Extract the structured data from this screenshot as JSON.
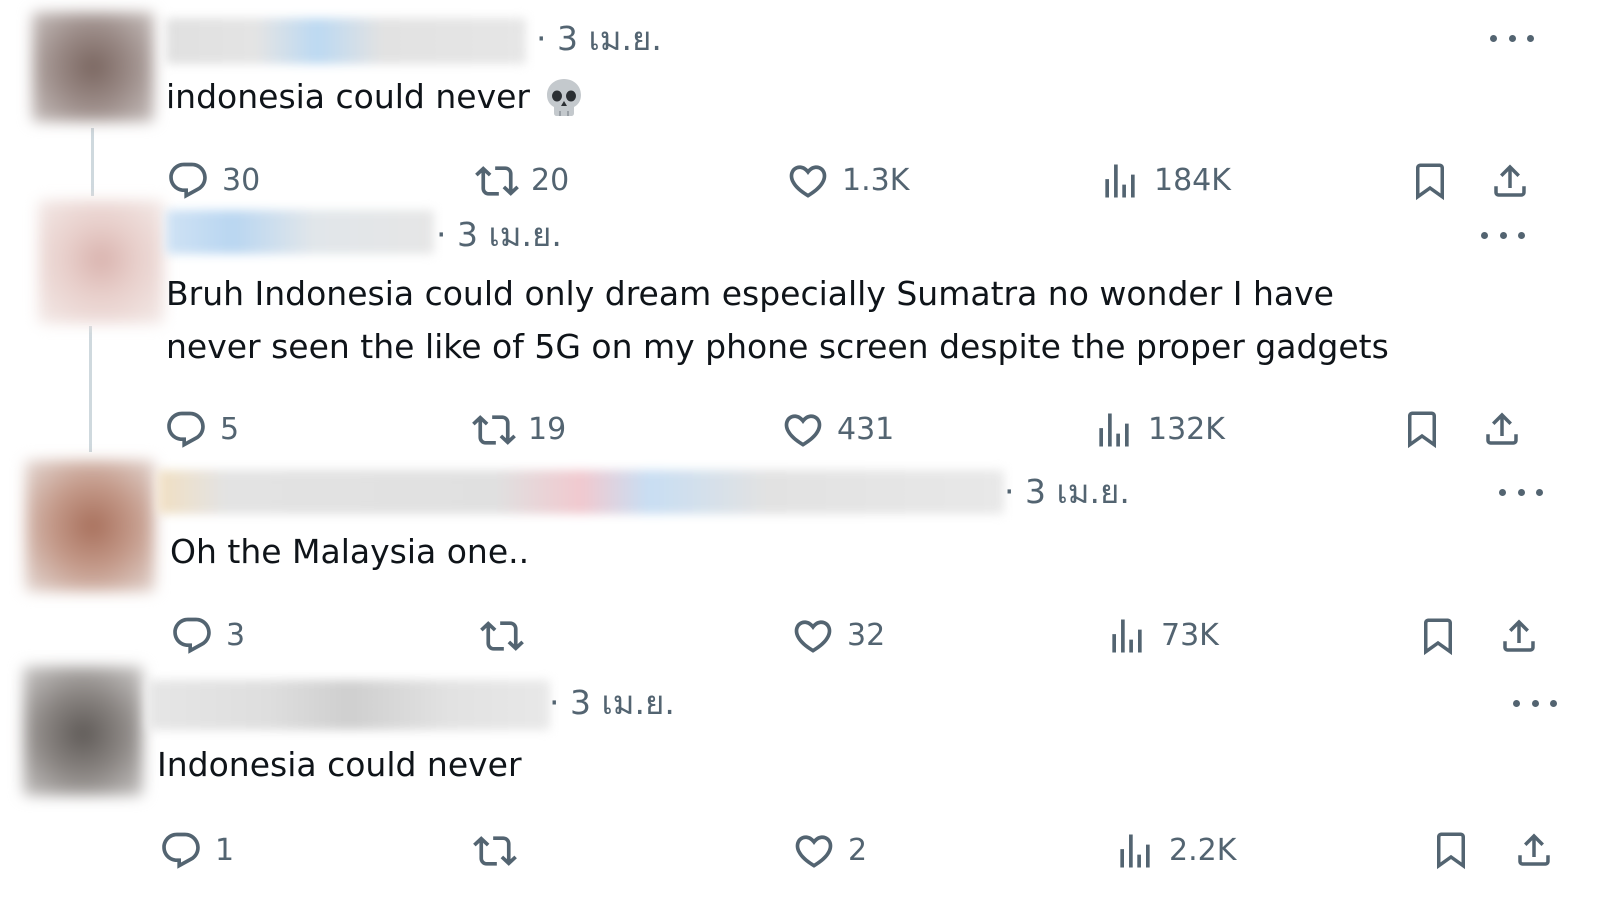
{
  "theme": {
    "text": "#0f1419",
    "muted": "#536471",
    "thread_line": "#cfd9de"
  },
  "icons": {
    "reply": "speech-bubble",
    "retweet": "retweet-arrows",
    "like": "heart",
    "views": "bar-chart",
    "bookmark": "bookmark",
    "share": "upload-arrow",
    "more": "three-dots"
  },
  "replies": [
    {
      "date": "· 3 เม.ย.",
      "text": "indonesia could never",
      "emoji": "skull",
      "stats": {
        "replies": "30",
        "retweets": "20",
        "likes": "1.3K",
        "views": "184K"
      }
    },
    {
      "date": "· 3 เม.ย.",
      "text_lines": [
        "Bruh Indonesia could only dream especially Sumatra no wonder I have",
        "never seen the like of 5G on my phone screen despite the proper gadgets"
      ],
      "stats": {
        "replies": "5",
        "retweets": "19",
        "likes": "431",
        "views": "132K"
      }
    },
    {
      "date": "· 3 เม.ย.",
      "text": "Oh the Malaysia one..",
      "stats": {
        "replies": "3",
        "retweets": "",
        "likes": "32",
        "views": "73K"
      }
    },
    {
      "date": "· 3 เม.ย.",
      "text": "Indonesia could never",
      "stats": {
        "replies": "1",
        "retweets": "",
        "likes": "2",
        "views": "2.2K"
      }
    }
  ]
}
